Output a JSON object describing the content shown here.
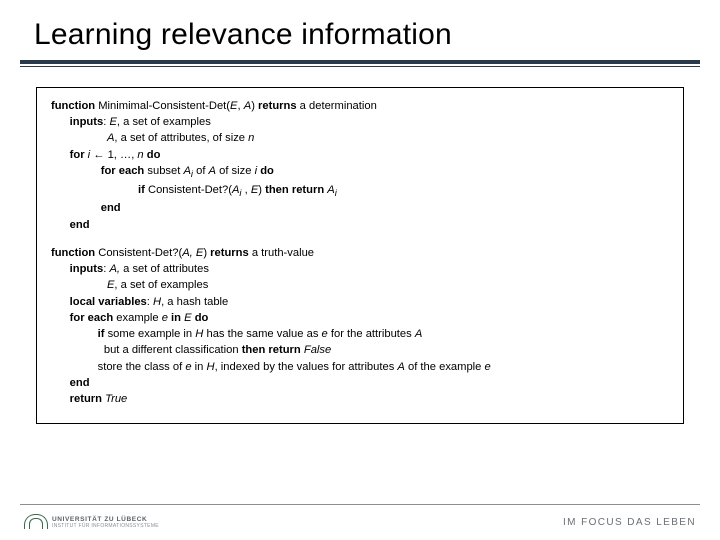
{
  "title": "Learning relevance information",
  "func1": {
    "l1_kw1": "function",
    "l1_name": " Minimimal-Consistent-Det(",
    "l1_arg1": "E",
    "l1_c1": ", ",
    "l1_arg2": "A",
    "l1_c2": ") ",
    "l1_kw2": "returns",
    "l1_tail": " a determination",
    "l2_kw": "inputs",
    "l2_c": ": ",
    "l2_v1": "E",
    "l2_t": ", a set of examples",
    "l3_v": "A",
    "l3_t1": ", a set of attributes, of size ",
    "l3_v2": "n",
    "l4_kw": "for",
    "l4_v1": " i ",
    "l4_arr": "← 1, …, ",
    "l4_v2": "n",
    "l4_sp": " ",
    "l4_kw2": "do",
    "l5_kw": "for each",
    "l5_t1": " subset ",
    "l5_v1": "A",
    "l5_sub": "i",
    "l5_t2": " of ",
    "l5_v2": "A",
    "l5_t3": " of size ",
    "l5_v3": "i",
    "l5_sp": " ",
    "l5_kw2": "do",
    "l6_kw": "if",
    "l6_t1": " Consistent-Det?(",
    "l6_v1": "A",
    "l6_sub": "i",
    "l6_t2": " , ",
    "l6_v2": "E",
    "l6_t3": ") ",
    "l6_kw2": "then return",
    "l6_sp": " ",
    "l6_v3": "A",
    "l6_sub2": "i",
    "l7_kw": "end",
    "l8_kw": "end"
  },
  "func2": {
    "l1_kw1": "function",
    "l1_t1": " Consistent-Det?(",
    "l1_v1": "A, E",
    "l1_t2": ") ",
    "l1_kw2": "returns",
    "l1_tail": " a truth-value",
    "l2_kw": "inputs",
    "l2_c": ": ",
    "l2_v": "A,",
    "l2_t": " a set of attributes",
    "l3_v": "E",
    "l3_t": ", a set of examples",
    "l4_kw": "local variables",
    "l4_c": ": ",
    "l4_v": "H",
    "l4_t": ", a hash table",
    "l5_kw": "for each",
    "l5_t1": " example ",
    "l5_v1": "e",
    "l5_sp1": " ",
    "l5_kw2": "in",
    "l5_sp2": " ",
    "l5_v2": "E",
    "l5_sp3": " ",
    "l5_kw3": "do",
    "l6_kw": "if",
    "l6_t1": " some example in ",
    "l6_v1": "H",
    "l6_t2": " has the same value as ",
    "l6_v2": "e",
    "l6_t3": " for the attributes ",
    "l6_v3": "A",
    "l7_t1": "but a different classification ",
    "l7_kw": "then return",
    "l7_sp": " ",
    "l7_v": "False",
    "l8_t1": "store the class of ",
    "l8_v1": "e",
    "l8_t2": " in ",
    "l8_v2": "H",
    "l8_t3": ", indexed by the values for attributes ",
    "l8_v3": "A",
    "l8_t4": " of the example ",
    "l8_v4": "e",
    "l9_kw": "end",
    "l10_kw": "return",
    "l10_sp": " ",
    "l10_v": "True"
  },
  "footer": {
    "uni1": "UNIVERSITÄT ZU LÜBECK",
    "uni2": "INSTITUT FÜR INFORMATIONSSYSTEME",
    "right": "IM FOCUS DAS LEBEN"
  }
}
